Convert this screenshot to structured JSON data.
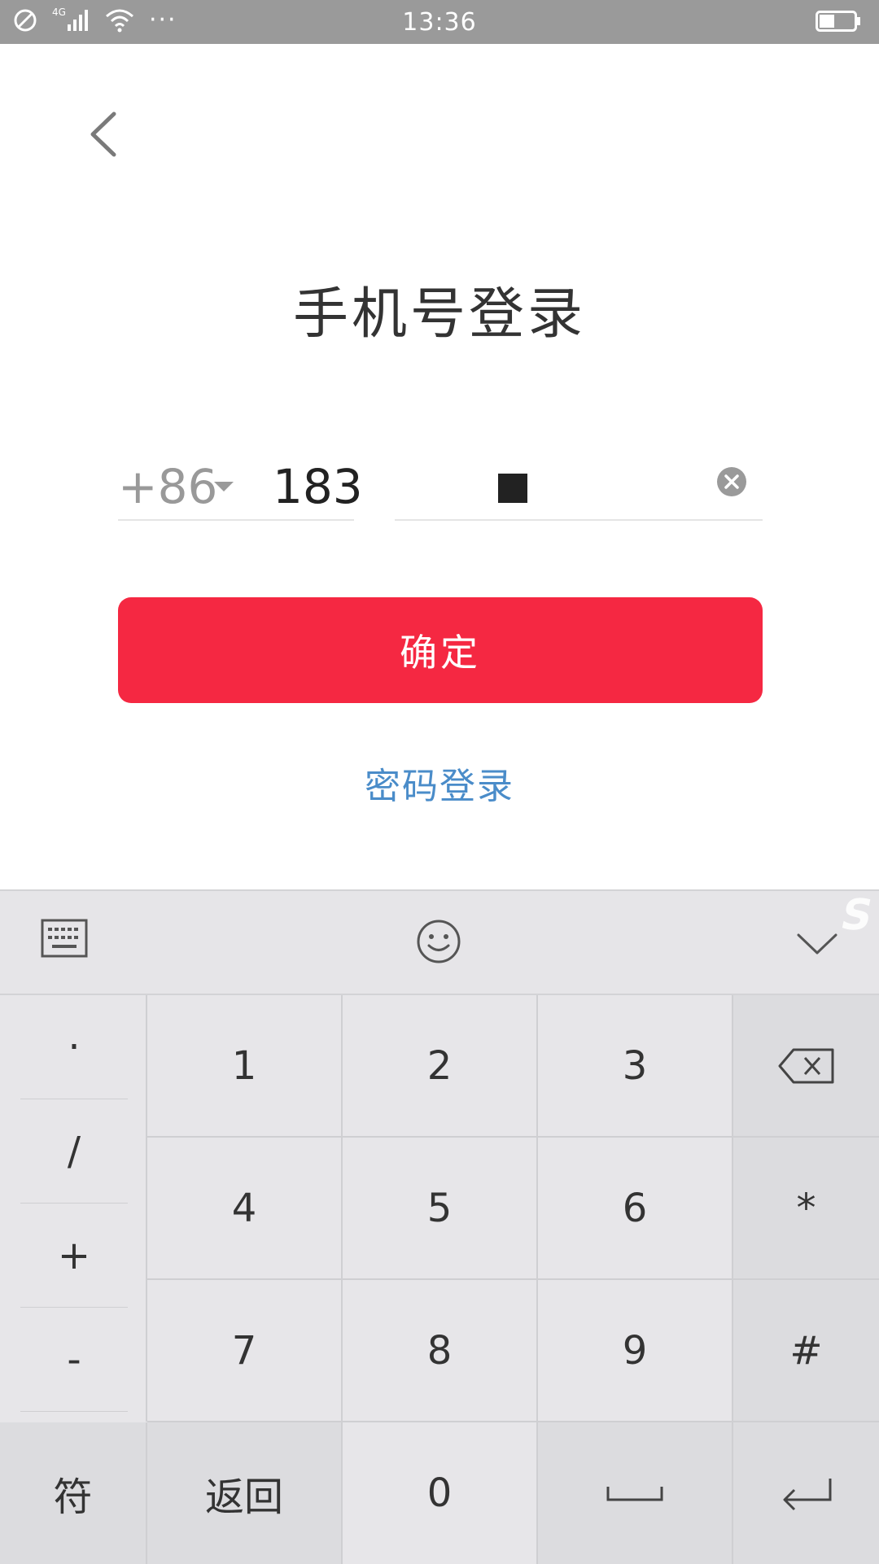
{
  "status_bar": {
    "time": "13:36",
    "network": "4G",
    "more": "···"
  },
  "page": {
    "title": "手机号登录",
    "country_code": "+86",
    "phone_prefix": "183",
    "confirm_label": "确定",
    "alt_login_label": "密码登录"
  },
  "keyboard": {
    "symbols": [
      "·",
      "/",
      "+",
      "-"
    ],
    "digits": [
      "1",
      "2",
      "3",
      "4",
      "5",
      "6",
      "7",
      "8",
      "9"
    ],
    "right_keys": [
      "*",
      "#"
    ],
    "bottom": {
      "fu": "符",
      "back": "返回",
      "zero": "0"
    }
  },
  "colors": {
    "accent": "#f52842",
    "link": "#4a8cc9",
    "statusbar": "#9a9a9a"
  }
}
